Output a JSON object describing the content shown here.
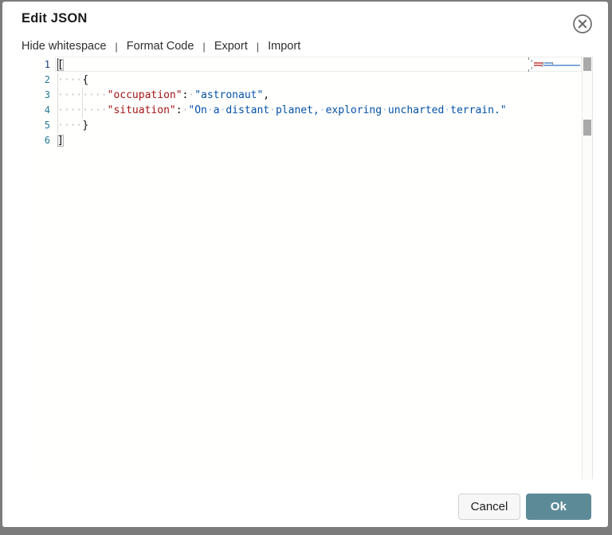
{
  "window": {
    "title": "Edit JSON"
  },
  "toolbar": {
    "separator": "|",
    "items": [
      {
        "label": "Hide whitespace"
      },
      {
        "label": "Format Code"
      },
      {
        "label": "Export"
      },
      {
        "label": "Import"
      }
    ]
  },
  "editor": {
    "language": "json",
    "active_line": 1,
    "whitespace_dot": "·",
    "lines": [
      {
        "num": 1,
        "tokens": [
          {
            "text": "[",
            "type": "punct",
            "bracket_match": true,
            "cursor_before": true
          }
        ]
      },
      {
        "num": 2,
        "tokens": [
          {
            "text": "    ",
            "type": "ws"
          },
          {
            "text": "{",
            "type": "punct"
          }
        ]
      },
      {
        "num": 3,
        "tokens": [
          {
            "text": "        ",
            "type": "ws"
          },
          {
            "text": "\"occupation\"",
            "type": "key"
          },
          {
            "text": ":",
            "type": "punct"
          },
          {
            "text": " ",
            "type": "ws"
          },
          {
            "text": "\"astronaut\"",
            "type": "str"
          },
          {
            "text": ",",
            "type": "punct"
          }
        ]
      },
      {
        "num": 4,
        "tokens": [
          {
            "text": "        ",
            "type": "ws"
          },
          {
            "text": "\"situation\"",
            "type": "key"
          },
          {
            "text": ":",
            "type": "punct"
          },
          {
            "text": " ",
            "type": "ws"
          },
          {
            "text": "\"On a distant planet, exploring uncharted terrain.\"",
            "type": "str",
            "show_ws": true
          }
        ]
      },
      {
        "num": 5,
        "tokens": [
          {
            "text": "    ",
            "type": "ws"
          },
          {
            "text": "}",
            "type": "punct"
          }
        ]
      },
      {
        "num": 6,
        "tokens": [
          {
            "text": "]",
            "type": "punct",
            "bracket_match": true
          }
        ]
      }
    ],
    "json_value": [
      {
        "occupation": "astronaut",
        "situation": "On a distant planet, exploring uncharted terrain."
      }
    ],
    "colors": {
      "key": "#A31515",
      "string": "#0451A5",
      "punctuation": "#111111",
      "line_number": "#237893",
      "active_line_number": "#1c3a7e",
      "whitespace": "#c2c2c2"
    }
  },
  "footer": {
    "buttons": [
      {
        "label": "Cancel",
        "role": "cancel"
      },
      {
        "label": "Ok",
        "role": "confirm",
        "color": "#5d8a97"
      }
    ]
  }
}
